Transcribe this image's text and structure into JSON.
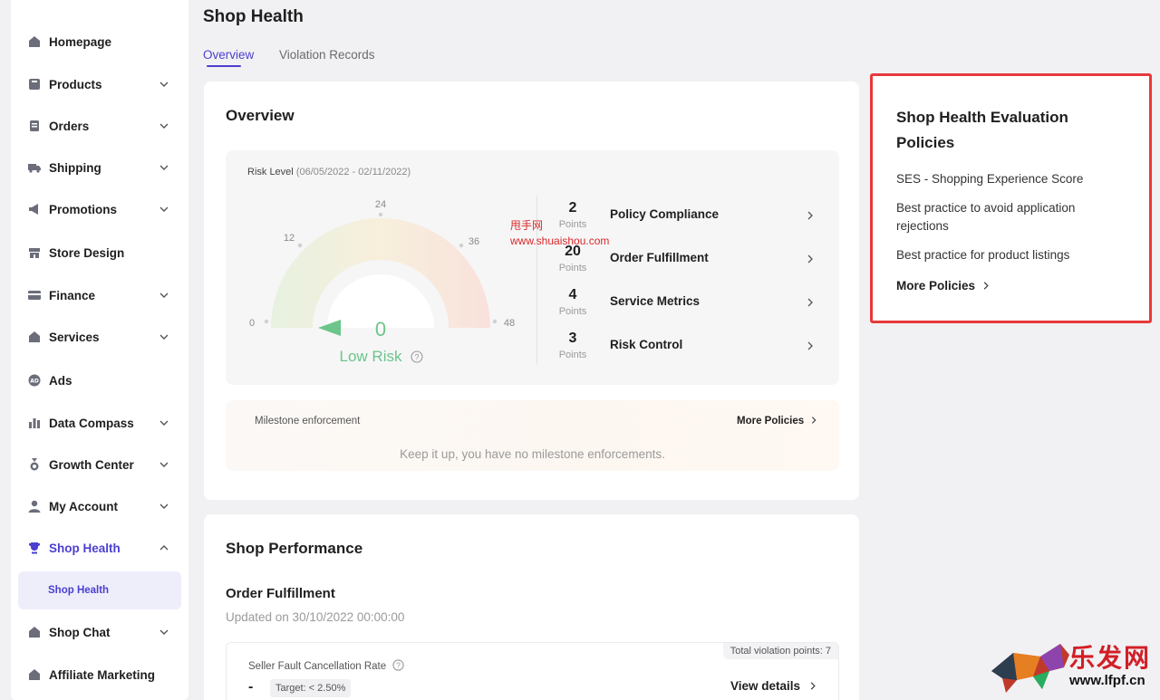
{
  "sidebar": {
    "items": [
      {
        "label": "Homepage",
        "icon": "home-icon",
        "chevron": false
      },
      {
        "label": "Products",
        "icon": "box-icon",
        "chevron": true
      },
      {
        "label": "Orders",
        "icon": "document-icon",
        "chevron": true
      },
      {
        "label": "Shipping",
        "icon": "truck-icon",
        "chevron": true
      },
      {
        "label": "Promotions",
        "icon": "megaphone-icon",
        "chevron": true
      },
      {
        "label": "Store Design",
        "icon": "store-icon",
        "chevron": false
      },
      {
        "label": "Finance",
        "icon": "card-icon",
        "chevron": true
      },
      {
        "label": "Services",
        "icon": "home-icon",
        "chevron": true
      },
      {
        "label": "Ads",
        "icon": "ad-icon",
        "chevron": false
      },
      {
        "label": "Data Compass",
        "icon": "bar-chart-icon",
        "chevron": true
      },
      {
        "label": "Growth Center",
        "icon": "medal-icon",
        "chevron": true
      },
      {
        "label": "My Account",
        "icon": "user-icon",
        "chevron": true
      },
      {
        "label": "Shop Health",
        "icon": "trophy-icon",
        "chevron": true,
        "active": true
      },
      {
        "label": "Shop Chat",
        "icon": "home-icon",
        "chevron": true
      },
      {
        "label": "Affiliate Marketing",
        "icon": "home-icon",
        "chevron": false
      }
    ],
    "sub_item": "Shop Health"
  },
  "header": {
    "title": "Shop Health",
    "tabs": [
      {
        "label": "Overview",
        "active": true
      },
      {
        "label": "Violation Records",
        "active": false
      }
    ]
  },
  "overview": {
    "title": "Overview",
    "risk_label": "Risk Level",
    "risk_dates": "(06/05/2022 - 02/11/2022)",
    "gauge": {
      "ticks": [
        "0",
        "12",
        "24",
        "36",
        "48"
      ],
      "value": "0",
      "value_numeric": 0,
      "max": 48,
      "status": "Low Risk"
    },
    "metrics": [
      {
        "points": "2",
        "unit": "Points",
        "name": "Policy Compliance"
      },
      {
        "points": "20",
        "unit": "Points",
        "name": "Order Fulfillment"
      },
      {
        "points": "4",
        "unit": "Points",
        "name": "Service Metrics"
      },
      {
        "points": "3",
        "unit": "Points",
        "name": "Risk Control"
      }
    ],
    "milestone": {
      "title": "Milestone enforcement",
      "more": "More Policies",
      "message": "Keep it up, you have no milestone enforcements."
    }
  },
  "performance": {
    "title": "Shop Performance",
    "section": "Order Fulfillment",
    "updated": "Updated on 30/10/2022 00:00:00",
    "violation_points": "Total violation points: 7",
    "metric_label": "Seller Fault Cancellation Rate",
    "metric_value": "-",
    "target": "Target: < 2.50%",
    "view_details": "View details"
  },
  "policies": {
    "title": "Shop Health Evaluation Policies",
    "links": [
      "SES - Shopping Experience Score",
      "Best practice to avoid application rejections",
      "Best practice for product listings"
    ],
    "more": "More Policies"
  },
  "watermarks": {
    "cn_text": "甩手网",
    "url_text": "www.shuaishou.com",
    "logo_cn": "乐发网",
    "logo_url": "www.lfpf.cn"
  },
  "colors": {
    "accent": "#4a3fd0",
    "highlight_border": "#e8393a",
    "low_risk": "#6cc58a"
  }
}
